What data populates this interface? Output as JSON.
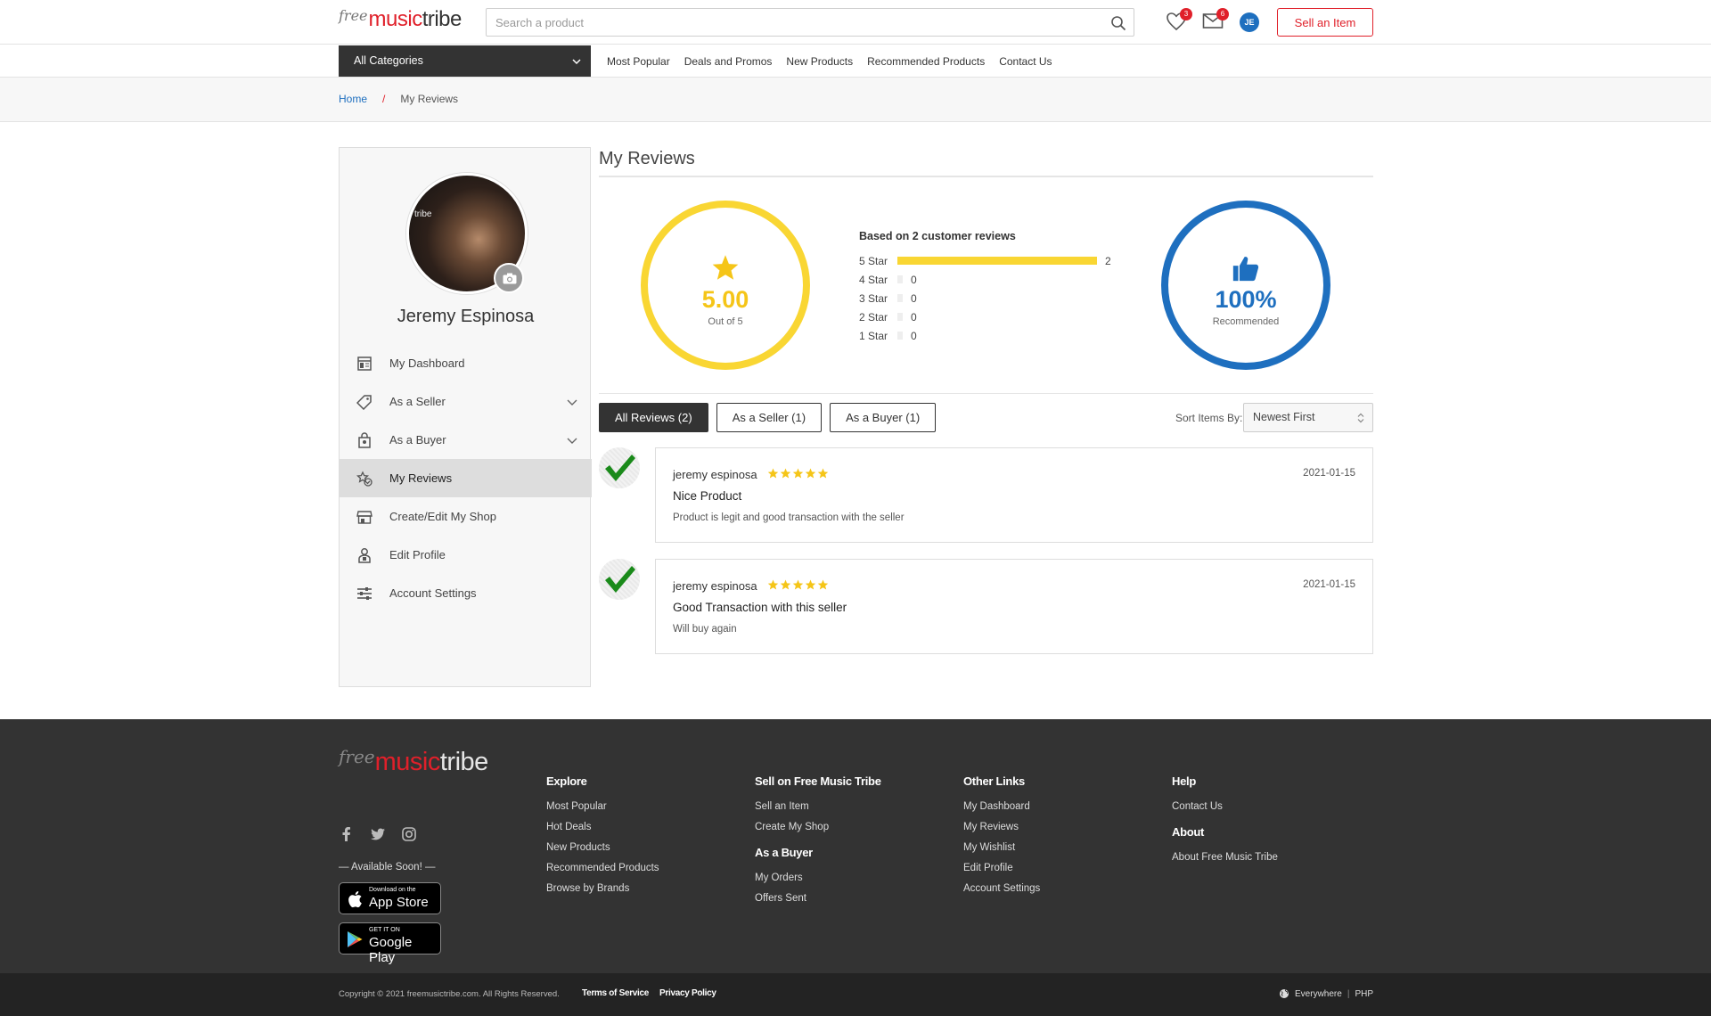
{
  "header": {
    "logo": {
      "free": "free",
      "music": "music",
      "tribe": "tribe"
    },
    "search_placeholder": "Search a product",
    "wishlist_count": "3",
    "messages_count": "6",
    "user_initials": "JE",
    "sell_label": "Sell an Item"
  },
  "nav": {
    "categories_label": "All Categories",
    "links": [
      "Most Popular",
      "Deals and Promos",
      "New Products",
      "Recommended Products",
      "Contact Us"
    ]
  },
  "breadcrumb": {
    "home": "Home",
    "sep": "/",
    "current": "My Reviews"
  },
  "sidebar": {
    "name": "Jeremy Espinosa",
    "photo_text": "tribe",
    "items": [
      {
        "label": "My Dashboard",
        "icon": "dashboard-icon"
      },
      {
        "label": "As a Seller",
        "icon": "tag-icon"
      },
      {
        "label": "As a Buyer",
        "icon": "bag-icon"
      },
      {
        "label": "My Reviews",
        "icon": "review-icon"
      },
      {
        "label": "Create/Edit My Shop",
        "icon": "shop-icon"
      },
      {
        "label": "Edit Profile",
        "icon": "profile-icon"
      },
      {
        "label": "Account Settings",
        "icon": "settings-icon"
      }
    ]
  },
  "reviews_page": {
    "title": "My Reviews",
    "rating": {
      "value": "5.00",
      "label": "Out of 5"
    },
    "recommend": {
      "value": "100%",
      "label": "Recommended"
    },
    "based_on": "Based on 2 customer reviews",
    "distribution": [
      {
        "label": "5 Star",
        "count": "2",
        "fraction": 1.0
      },
      {
        "label": "4 Star",
        "count": "0",
        "fraction": 0
      },
      {
        "label": "3 Star",
        "count": "0",
        "fraction": 0
      },
      {
        "label": "2 Star",
        "count": "0",
        "fraction": 0
      },
      {
        "label": "1 Star",
        "count": "0",
        "fraction": 0
      }
    ],
    "tabs": [
      "All Reviews (2)",
      "As a Seller (1)",
      "As a Buyer (1)"
    ],
    "sort_label": "Sort Items By:",
    "sort_value": "Newest First",
    "reviews": [
      {
        "name": "jeremy espinosa",
        "stars": 5,
        "date": "2021-01-15",
        "title": "Nice Product",
        "body": "Product is legit and good transaction with the seller"
      },
      {
        "name": "jeremy espinosa",
        "stars": 5,
        "date": "2021-01-15",
        "title": "Good Transaction with this seller",
        "body": "Will buy again"
      }
    ]
  },
  "footer": {
    "available": "— Available Soon! —",
    "app_store": {
      "line1": "Download on the",
      "line2": "App Store"
    },
    "google_play": {
      "line1": "GET IT ON",
      "line2": "Google Play"
    },
    "columns": {
      "explore": {
        "title": "Explore",
        "links": [
          "Most Popular",
          "Hot Deals",
          "New Products",
          "Recommended Products",
          "Browse by Brands"
        ]
      },
      "sell": {
        "title": "Sell on Free Music Tribe",
        "links": [
          "Sell an Item",
          "Create My Shop"
        ]
      },
      "buyer": {
        "title": "As a Buyer",
        "links": [
          "My Orders",
          "Offers Sent"
        ]
      },
      "other": {
        "title": "Other Links",
        "links": [
          "My Dashboard",
          "My Reviews",
          "My Wishlist",
          "Edit Profile",
          "Account Settings"
        ]
      },
      "help": {
        "title": "Help",
        "links": [
          "Contact Us"
        ]
      },
      "about": {
        "title": "About",
        "links": [
          "About Free Music Tribe"
        ]
      }
    },
    "copyright": "Copyright © 2021 freemusictribe.com. All Rights Reserved.",
    "terms": "Terms of Service",
    "privacy": "Privacy Policy",
    "region": "Everywhere",
    "currency": "PHP"
  },
  "colors": {
    "brand_red": "#e0202a",
    "star_gold": "#f9d633",
    "accent_blue": "#1e6fbf"
  }
}
